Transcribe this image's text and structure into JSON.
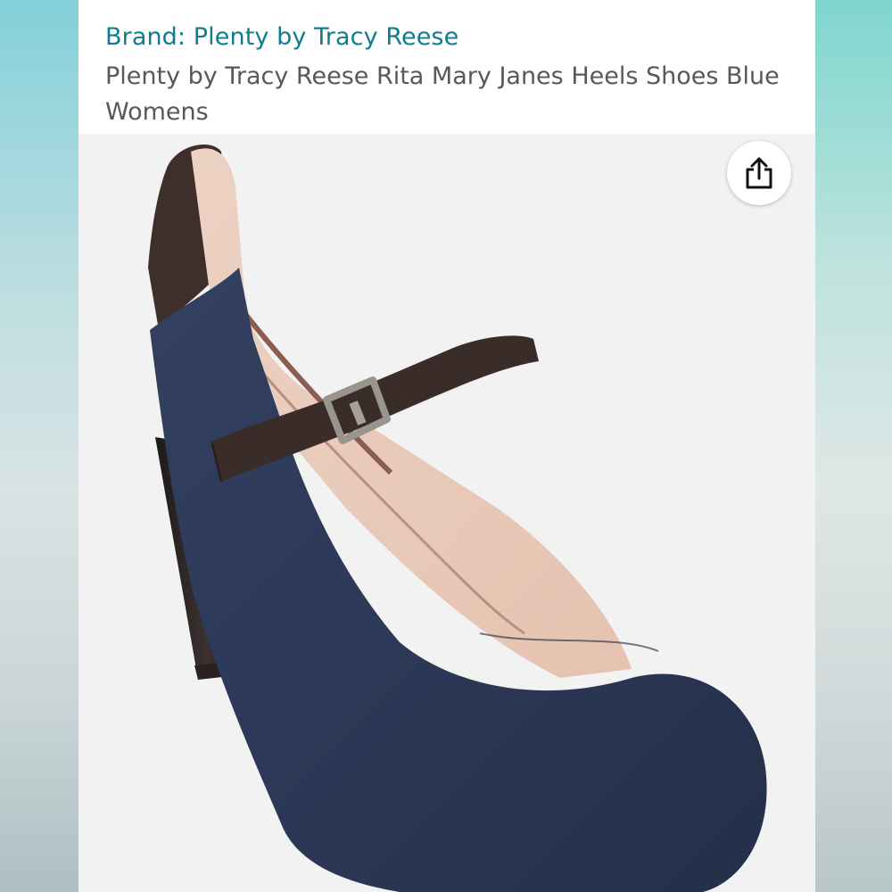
{
  "product": {
    "brand_text": "Brand: Plenty by Tracy Reese",
    "title": "Plenty by Tracy Reese Rita Mary Janes Heels Shoes Blue Womens"
  },
  "image": {
    "subject": "navy-suede-mary-jane-pump"
  },
  "actions": {
    "share_icon": "share-icon"
  },
  "colors": {
    "brand_link": "#0f7c90",
    "title_text": "#565959",
    "suede": "#2e3a5c",
    "leather": "#3e2e2a"
  }
}
